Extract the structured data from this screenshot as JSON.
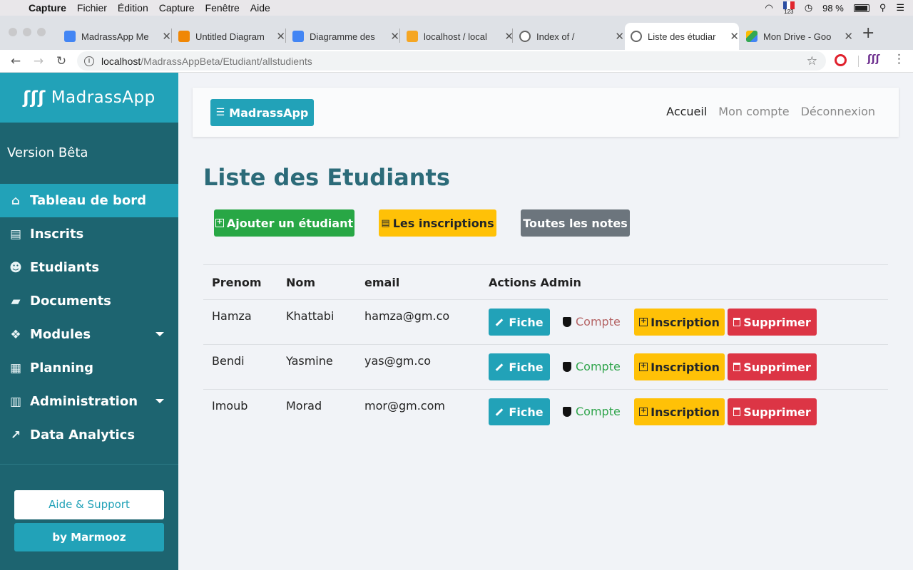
{
  "mac_menu": {
    "app": "Capture",
    "items": [
      "Fichier",
      "Édition",
      "Capture",
      "Fenêtre",
      "Aide"
    ],
    "flag_label": "123",
    "battery": "98 %"
  },
  "browser": {
    "tabs": [
      {
        "title": "MadrassApp Me",
        "icon_color": "#4285f4"
      },
      {
        "title": "Untitled Diagram",
        "icon_color": "#f08705"
      },
      {
        "title": "Diagramme des",
        "icon_color": "#4285f4"
      },
      {
        "title": "localhost / local",
        "icon_color": "#f5a623"
      },
      {
        "title": "Index of /",
        "icon_color": "#666666"
      },
      {
        "title": "Liste des étudiar",
        "icon_color": "#666666"
      },
      {
        "title": "Mon Drive - Goo",
        "icon_color": "#34a853"
      }
    ],
    "url_host": "localhost",
    "url_path": "/MadrassAppBeta/Etudiant/allstudients"
  },
  "sidebar": {
    "brand": "MadrassApp",
    "brand_mark": "ʃʃʃ",
    "version": "Version Bêta",
    "items": [
      {
        "label": "Tableau de bord",
        "icon": "⌂"
      },
      {
        "label": "Inscrits",
        "icon": "▤"
      },
      {
        "label": "Etudiants",
        "icon": "☻"
      },
      {
        "label": "Documents",
        "icon": "▰"
      },
      {
        "label": "Modules",
        "icon": "❖"
      },
      {
        "label": "Planning",
        "icon": "▦"
      },
      {
        "label": "Administration",
        "icon": "▥"
      },
      {
        "label": "Data Analytics",
        "icon": "↗"
      }
    ],
    "help_label": "Aide & Support",
    "by_label": "by Marmooz"
  },
  "topnav": {
    "brand_button": "MadrassApp",
    "links": [
      "Accueil",
      "Mon compte",
      "Déconnexion"
    ]
  },
  "page": {
    "title": "Liste des Etudiants",
    "add_button": "Ajouter un étudiant",
    "inscriptions_button": "Les inscriptions",
    "notes_button": "Toutes les notes"
  },
  "table": {
    "headers": [
      "Prenom",
      "Nom",
      "email",
      "Actions Admin"
    ],
    "rows": [
      {
        "prenom": "Hamza",
        "nom": "Khattabi",
        "email": "hamza@gm.co",
        "compte_status": "inactive"
      },
      {
        "prenom": "Bendi",
        "nom": "Yasmine",
        "email": "yas@gm.co",
        "compte_status": "active"
      },
      {
        "prenom": "Imoub",
        "nom": "Morad",
        "email": "mor@gm.com",
        "compte_status": "active"
      }
    ],
    "fiche_label": "Fiche",
    "compte_label": "Compte",
    "inscription_label": "Inscription",
    "supprimer_label": "Supprimer"
  },
  "colors": {
    "primary": "#22a2b8",
    "sidebar": "#1d6470",
    "success": "#28a745",
    "warning": "#ffc107",
    "danger": "#dc3545",
    "secondary": "#6c757d",
    "compte_inactive": "#b56465",
    "compte_active": "#2fa44b"
  }
}
